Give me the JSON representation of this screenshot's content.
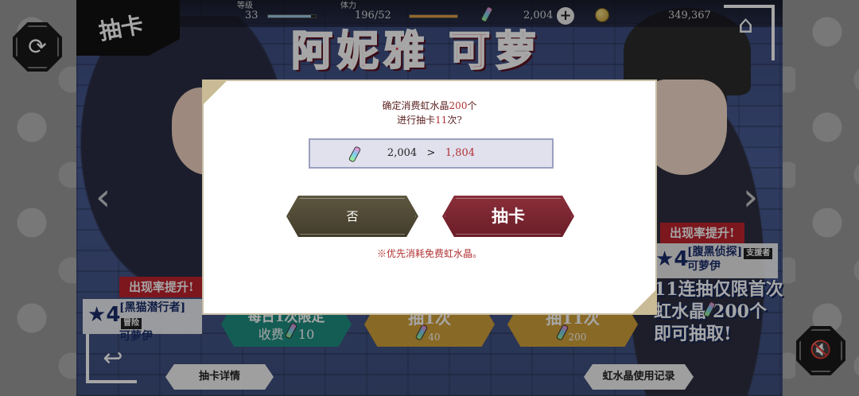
{
  "screen": {
    "title": "抽卡",
    "banner_title": "阿妮雅 可萝"
  },
  "status": {
    "level_label": "等级",
    "level_value": "33",
    "stamina_label": "体力",
    "stamina_value": "196/52",
    "crystals": "2,004",
    "coins": "349,367",
    "colors": {
      "level_bar": "#9fc9e8",
      "stamina_bar": "#e0a040"
    }
  },
  "icons": {
    "refresh": "⟳",
    "home": "⌂",
    "back": "↩",
    "mute": "🔇",
    "prev": "‹",
    "next": "›",
    "plus": "+",
    "star": "★"
  },
  "left_featured": {
    "rate_up": "出现率提升!",
    "rarity": "4",
    "epithet": "[黑猫潜行者]",
    "role": "冒险",
    "name": "可萝伊"
  },
  "right_featured": {
    "rate_up": "出现率提升!",
    "rarity": "4",
    "epithet": "[腹黑侦探]",
    "role": "支援者",
    "name": "可萝伊"
  },
  "promo": {
    "line1": "11连抽仅限首次",
    "line2": "虹水晶",
    "line2_amount": "200个",
    "line3": "即可抽取!"
  },
  "pull_buttons": [
    {
      "label": "每日1次限定",
      "sub": "收费",
      "cost": "10"
    },
    {
      "label": "抽1次",
      "cost": "40"
    },
    {
      "label": "抽11次",
      "cost": "200"
    }
  ],
  "bottom": {
    "details": "抽卡详情",
    "history": "虹水晶使用记录"
  },
  "dialog": {
    "line1_pre": "确定消费虹水晶",
    "line1_amount": "200",
    "line1_post": "个",
    "line2_pre": "进行抽卡",
    "line2_count": "11",
    "line2_post": "次?",
    "before": "2,004",
    "arrow": ">",
    "after": "1,804",
    "no": "否",
    "yes": "抽卡",
    "note": "※优先消耗免费虹水晶。"
  }
}
